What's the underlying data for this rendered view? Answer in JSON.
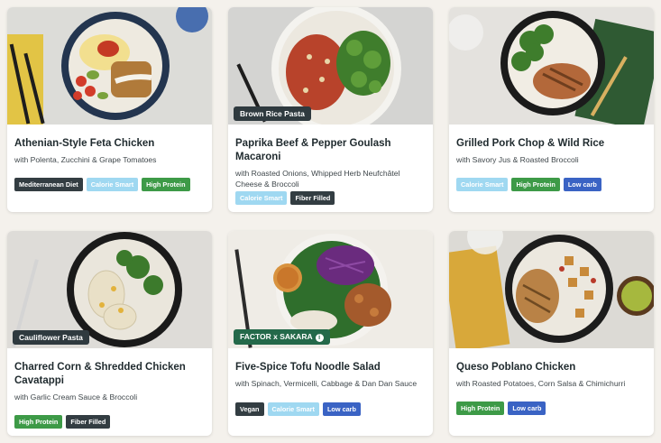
{
  "meals": [
    {
      "title": "Athenian-Style Feta Chicken",
      "subtitle": "with Polenta, Zucchini & Grape Tomatoes",
      "tag": "",
      "badges": [
        {
          "label": "Mediterranean Diet",
          "style": "dark"
        },
        {
          "label": "Calorie Smart",
          "style": "sky"
        },
        {
          "label": "High Protein",
          "style": "green"
        }
      ]
    },
    {
      "title": "Paprika Beef & Pepper Goulash Macaroni",
      "subtitle": "with Roasted Onions, Whipped Herb Neufchâtel Cheese & Broccoli",
      "tag": "Brown Rice Pasta",
      "badges": [
        {
          "label": "Calorie Smart",
          "style": "sky"
        },
        {
          "label": "Fiber Filled",
          "style": "dark"
        }
      ]
    },
    {
      "title": "Grilled Pork Chop & Wild Rice",
      "subtitle": "with Savory Jus & Roasted Broccoli",
      "tag": "",
      "badges": [
        {
          "label": "Calorie Smart",
          "style": "sky"
        },
        {
          "label": "High Protein",
          "style": "green"
        },
        {
          "label": "Low carb",
          "style": "blue"
        }
      ]
    },
    {
      "title": "Charred Corn & Shredded Chicken Cavatappi",
      "subtitle": "with Garlic Cream Sauce & Broccoli",
      "tag": "Cauliflower Pasta",
      "badges": [
        {
          "label": "High Protein",
          "style": "green"
        },
        {
          "label": "Fiber Filled",
          "style": "dark"
        }
      ]
    },
    {
      "title": "Five-Spice Tofu Noodle Salad",
      "subtitle": "with Spinach, Vermicelli, Cabbage & Dan Dan Sauce",
      "tag": "FACTOR x SAKARA",
      "badges": [
        {
          "label": "Vegan",
          "style": "dark"
        },
        {
          "label": "Calorie Smart",
          "style": "sky"
        },
        {
          "label": "Low carb",
          "style": "blue"
        }
      ]
    },
    {
      "title": "Queso Poblano Chicken",
      "subtitle": "with Roasted Potatoes, Corn Salsa & Chimichurri",
      "tag": "",
      "badges": [
        {
          "label": "High Protein",
          "style": "green"
        },
        {
          "label": "Low carb",
          "style": "blue"
        }
      ]
    }
  ],
  "colors": {
    "page_bg": "#f4f1ec",
    "tag_dark": "#2f3a3f",
    "tag_green": "#24694a",
    "badge_dark": "#333d42",
    "badge_sky": "#9fd8f1",
    "badge_green": "#3d9a47",
    "badge_blue": "#3a63c4"
  }
}
